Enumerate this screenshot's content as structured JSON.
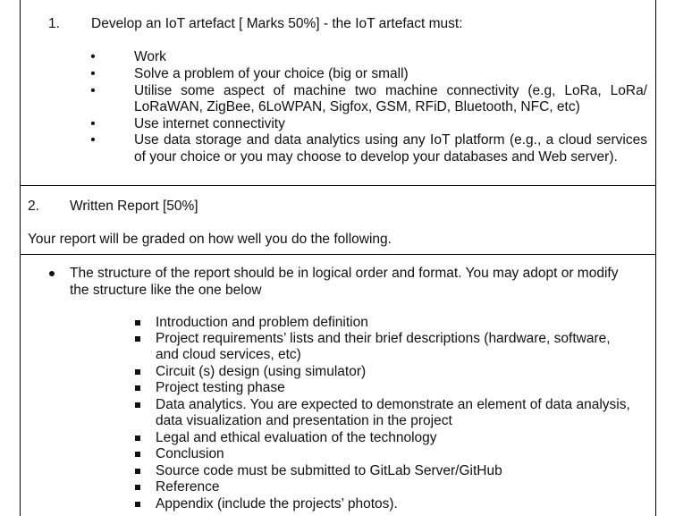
{
  "item1": {
    "number": "1.",
    "heading": "Develop an IoT artefact [ Marks 50%] - the IoT artefact must:",
    "bullets": [
      [
        "Work"
      ],
      [
        "Solve a problem of your choice (big or small)"
      ],
      [
        "Utilise some aspect of machine two machine connectivity (e.g, LoRa, LoRa/",
        "LoRaWAN, ZigBee, 6LoWPAN, Sigfox, GSM, RFiD, Bluetooth, NFC, etc)"
      ],
      [
        "Use internet connectivity"
      ],
      [
        "Use data storage and data analytics using any IoT platform (e.g., a cloud services",
        "of your choice or you may choose to develop your databases and Web server)."
      ]
    ]
  },
  "item2": {
    "number": "2.",
    "heading": "Written Report [50%]",
    "intro": "Your report will be graded on how well you do the following.",
    "structure_point": [
      "The structure of the report should be in logical order and format. You may adopt or modify",
      "the structure like the one below"
    ],
    "structure_items": [
      [
        "Introduction and problem definition"
      ],
      [
        "Project requirements’ lists and their brief descriptions (hardware, software,",
        "and cloud services, etc)"
      ],
      [
        "Circuit (s) design (using simulator)"
      ],
      [
        "Project testing phase"
      ],
      [
        "Data analytics. You are expected to demonstrate an element of data analysis,",
        "data visualization and presentation in the project"
      ],
      [
        "Legal and ethical evaluation of the technology"
      ],
      [
        "Conclusion"
      ],
      [
        "Source code must be submitted to GitLab Server/GitHub"
      ],
      [
        "Reference"
      ],
      [
        "Appendix (include the projects’ photos)."
      ]
    ]
  }
}
